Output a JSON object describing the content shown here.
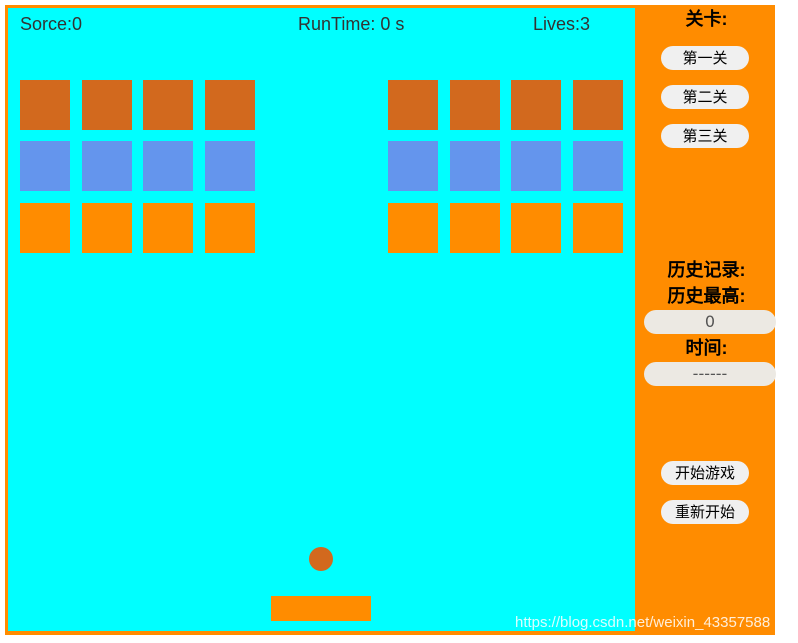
{
  "hud": {
    "score_text": "Sorce:0",
    "time_text": "RunTime: 0 s",
    "lives_text": "Lives:3"
  },
  "colors": {
    "frame": "#ff8c00",
    "playfield": "#00ffff",
    "ball": "#d2691e",
    "paddle": "#ff8c00"
  },
  "bricks": {
    "left_block": [
      [
        "#d2691e",
        "#d2691e",
        "#d2691e",
        "#d2691e"
      ],
      [
        "#6495ed",
        "#6495ed",
        "#6495ed",
        "#6495ed"
      ],
      [
        "#ff8c00",
        "#ff8c00",
        "#ff8c00",
        "#ff8c00"
      ]
    ],
    "right_block": [
      [
        "#d2691e",
        "#d2691e",
        "#d2691e",
        "#d2691e"
      ],
      [
        "#6495ed",
        "#6495ed",
        "#6495ed",
        "#6495ed"
      ],
      [
        "#ff8c00",
        "#ff8c00",
        "#ff8c00",
        "#ff8c00"
      ]
    ]
  },
  "sidebar": {
    "levels_title": "关卡:",
    "level_buttons": [
      "第一关",
      "第二关",
      "第三关"
    ],
    "history_title": "历史记录:",
    "best_title": "历史最高:",
    "best_value": "0",
    "time_title": "时间:",
    "time_value": "------",
    "start_label": "开始游戏",
    "restart_label": "重新开始"
  },
  "watermark": "https://blog.csdn.net/weixin_43357588"
}
